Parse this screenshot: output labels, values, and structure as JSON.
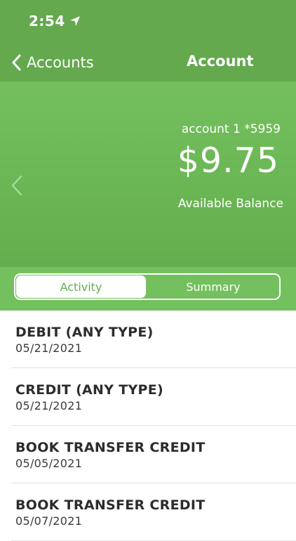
{
  "status_bar": {
    "time": "2:54"
  },
  "nav": {
    "back_label": "Accounts",
    "title": "Account"
  },
  "account": {
    "name": "account 1 *5959",
    "balance": "$9.75",
    "balance_caption": "Available Balance"
  },
  "tabs": [
    {
      "label": "Activity",
      "selected": true
    },
    {
      "label": "Summary",
      "selected": false
    }
  ],
  "transactions": [
    {
      "description": "DEBIT (ANY TYPE)",
      "date": "05/21/2021"
    },
    {
      "description": "CREDIT (ANY TYPE)",
      "date": "05/21/2021"
    },
    {
      "description": "BOOK TRANSFER CREDIT",
      "date": "05/05/2021"
    },
    {
      "description": "BOOK TRANSFER CREDIT",
      "date": "05/07/2021"
    }
  ],
  "colors": {
    "header_green": "#64a94e",
    "panel_green": "#6ab554",
    "accent_green": "#63ad4d",
    "text_dark": "#2c2c2c"
  },
  "icons": {
    "status": "location-arrow-icon",
    "back": "chevron-left-icon",
    "previous_account": "chevron-left-icon"
  }
}
